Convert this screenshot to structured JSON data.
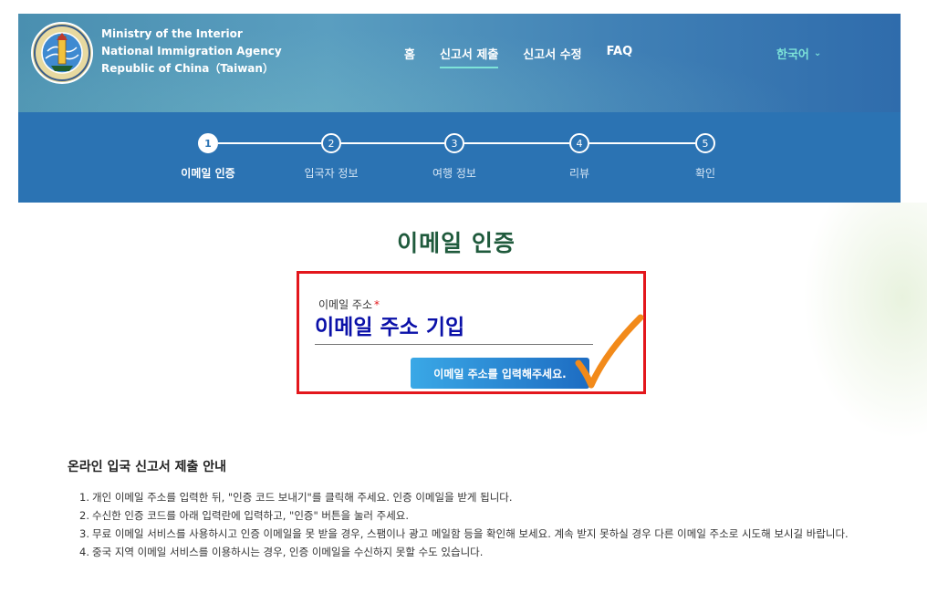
{
  "header": {
    "agency_lines": [
      "Ministry of the Interior",
      "National Immigration Agency",
      "Republic of China（Taiwan）"
    ],
    "nav": [
      {
        "label": "홈",
        "active": false
      },
      {
        "label": "신고서 제출",
        "active": true
      },
      {
        "label": "신고서 수정",
        "active": false
      },
      {
        "label": "FAQ",
        "active": false
      }
    ],
    "language": "한국어",
    "colors": {
      "header_bg": "#4a8fb0",
      "nav_active_underline": "#7de3d8",
      "language_text": "#7de3d8"
    }
  },
  "stepper": {
    "current_step": 1,
    "steps": [
      {
        "number": "1",
        "label": "이메일 인증"
      },
      {
        "number": "2",
        "label": "입국자 정보"
      },
      {
        "number": "3",
        "label": "여행 정보"
      },
      {
        "number": "4",
        "label": "리뷰"
      },
      {
        "number": "5",
        "label": "확인"
      }
    ],
    "colors": {
      "bg": "#2b73b3"
    }
  },
  "main": {
    "title": "이메일 인증",
    "email_label": "이메일 주소",
    "required_mark": "*",
    "email_input": {
      "value": "",
      "placeholder": "이메일 주소 기입"
    },
    "submit_label": "이메일 주소를 입력해주세요.",
    "colors": {
      "title": "#1f5a3c",
      "highlight_box": "#e3171c",
      "checkmark": "#f28a1a",
      "placeholder_text": "#0a10a8"
    }
  },
  "guide": {
    "title": "온라인 입국 신고서 제출 안내",
    "items": [
      {
        "num": "1.",
        "text": "개인 이메일 주소를 입력한 뒤, \"인증 코드 보내기\"를 클릭해 주세요. 인증 이메일을 받게 됩니다."
      },
      {
        "num": "2.",
        "text": "수신한 인증 코드를 아래 입력란에 입력하고, \"인증\" 버튼을 눌러 주세요."
      },
      {
        "num": "3.",
        "text": "무료 이메일 서비스를 사용하시고 인증 이메일을 못 받을 경우, 스팸이나 광고 메일함 등을 확인해 보세요. 계속 받지 못하실 경우 다른 이메일 주소로 시도해 보시길 바랍니다."
      },
      {
        "num": "4.",
        "text": "중국 지역 이메일 서비스를 이용하시는 경우, 인증 이메일을 수신하지 못할 수도 있습니다."
      }
    ]
  },
  "icons": {
    "logo": "agency-emblem",
    "language_chevron": "chevron-down-icon",
    "annotation": "checkmark-icon"
  }
}
